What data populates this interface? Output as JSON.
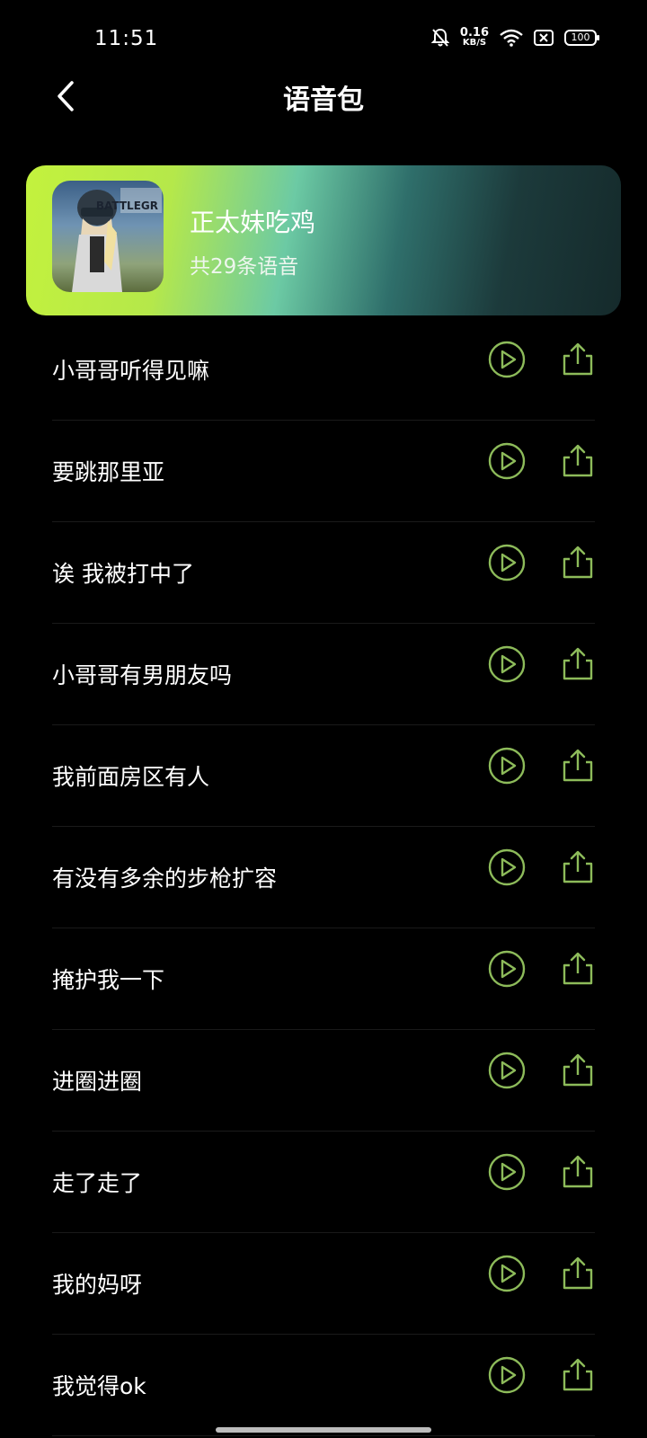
{
  "status_bar": {
    "time": "11:51",
    "net_speed_value": "0.16",
    "net_speed_unit": "KB/S",
    "battery": "100"
  },
  "header": {
    "title": "语音包"
  },
  "pack": {
    "name": "正太妹吃鸡",
    "count": "共29条语音",
    "cover_text": "BATTLEGR"
  },
  "colors": {
    "accent": "#8dbb5a",
    "background": "#000000"
  },
  "voices": [
    {
      "label": "小哥哥听得见嘛"
    },
    {
      "label": "要跳那里亚"
    },
    {
      "label": "诶 我被打中了"
    },
    {
      "label": "小哥哥有男朋友吗"
    },
    {
      "label": "我前面房区有人"
    },
    {
      "label": "有没有多余的步枪扩容"
    },
    {
      "label": "掩护我一下"
    },
    {
      "label": "进圈进圈"
    },
    {
      "label": "走了走了"
    },
    {
      "label": "我的妈呀"
    },
    {
      "label": "我觉得ok"
    }
  ]
}
